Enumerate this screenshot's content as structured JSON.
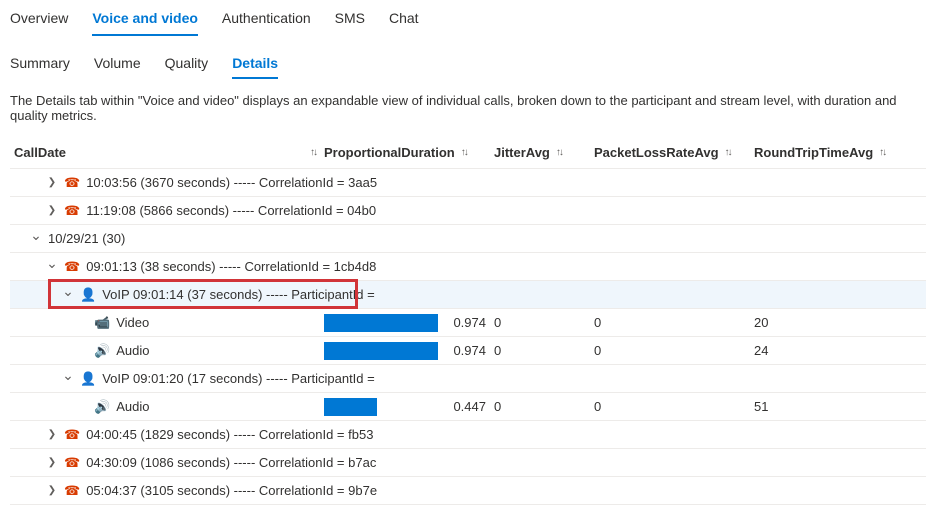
{
  "tabs": {
    "overview": "Overview",
    "voice_video": "Voice and video",
    "authentication": "Authentication",
    "sms": "SMS",
    "chat": "Chat"
  },
  "subtabs": {
    "summary": "Summary",
    "volume": "Volume",
    "quality": "Quality",
    "details": "Details"
  },
  "description": "The Details tab within \"Voice and video\" displays an expandable view of individual calls, broken down to the participant and stream level, with duration and quality metrics.",
  "columns": {
    "call_date": "CallDate",
    "prop_duration": "ProportionalDuration",
    "jitter_avg": "JitterAvg",
    "packet_loss": "PacketLossRateAvg",
    "rtt": "RoundTripTimeAvg"
  },
  "rows": {
    "r0": {
      "label": "10:03:56 (3670 seconds) ----- CorrelationId = 3aa5"
    },
    "r1": {
      "label": "11:19:08 (5866 seconds) ----- CorrelationId = 04b0"
    },
    "r2": {
      "label": "10/29/21 (30)"
    },
    "r3": {
      "label": "09:01:13 (38 seconds) ----- CorrelationId = 1cb4d8"
    },
    "r4": {
      "label": "VoIP 09:01:14 (37 seconds) ----- ParticipantId ="
    },
    "r5": {
      "label": "Video",
      "bar": 0.974,
      "bar_label": "0.974",
      "jitter": "0",
      "loss": "0",
      "rtt": "20"
    },
    "r6": {
      "label": "Audio",
      "bar": 0.974,
      "bar_label": "0.974",
      "jitter": "0",
      "loss": "0",
      "rtt": "24"
    },
    "r7": {
      "label": "VoIP 09:01:20 (17 seconds) ----- ParticipantId ="
    },
    "r8": {
      "label": "Audio",
      "bar": 0.447,
      "bar_label": "0.447",
      "jitter": "0",
      "loss": "0",
      "rtt": "51"
    },
    "r9": {
      "label": "04:00:45 (1829 seconds) ----- CorrelationId = fb53"
    },
    "r10": {
      "label": "04:30:09 (1086 seconds) ----- CorrelationId = b7ac"
    },
    "r11": {
      "label": "05:04:37 (3105 seconds) ----- CorrelationId = 9b7e"
    }
  }
}
